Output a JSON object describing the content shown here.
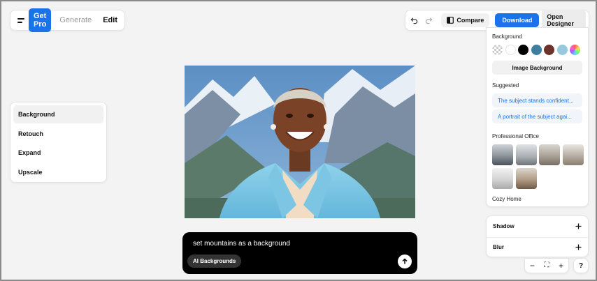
{
  "topbar": {
    "get_pro_label": "Get Pro",
    "generate_label": "Generate",
    "edit_label": "Edit",
    "compare_label": "Compare",
    "download_label": "Download",
    "open_designer_label": "Open Designer"
  },
  "tools": {
    "items": [
      {
        "label": "Background",
        "active": true
      },
      {
        "label": "Retouch"
      },
      {
        "label": "Expand"
      },
      {
        "label": "Upscale"
      }
    ]
  },
  "prompt": {
    "text": "set mountains as a background",
    "chip_label": "AI Backgrounds"
  },
  "right_panel": {
    "background_title": "Background",
    "swatches": [
      "transparent",
      "#ffffff",
      "#000000",
      "#3d7f9c",
      "#6b3329",
      "#96c9dd",
      "rainbow"
    ],
    "image_background_label": "Image Background",
    "suggested_title": "Suggested",
    "suggestions": [
      "The subject stands confident...",
      "A portrait of the subject agai..."
    ],
    "professional_office_title": "Professional Office",
    "cozy_home_title": "Cozy Home"
  },
  "effects": {
    "shadow_label": "Shadow",
    "blur_label": "Blur"
  },
  "zoom": {
    "minus": "−",
    "fit": "⛶",
    "plus": "+",
    "help": "?"
  }
}
